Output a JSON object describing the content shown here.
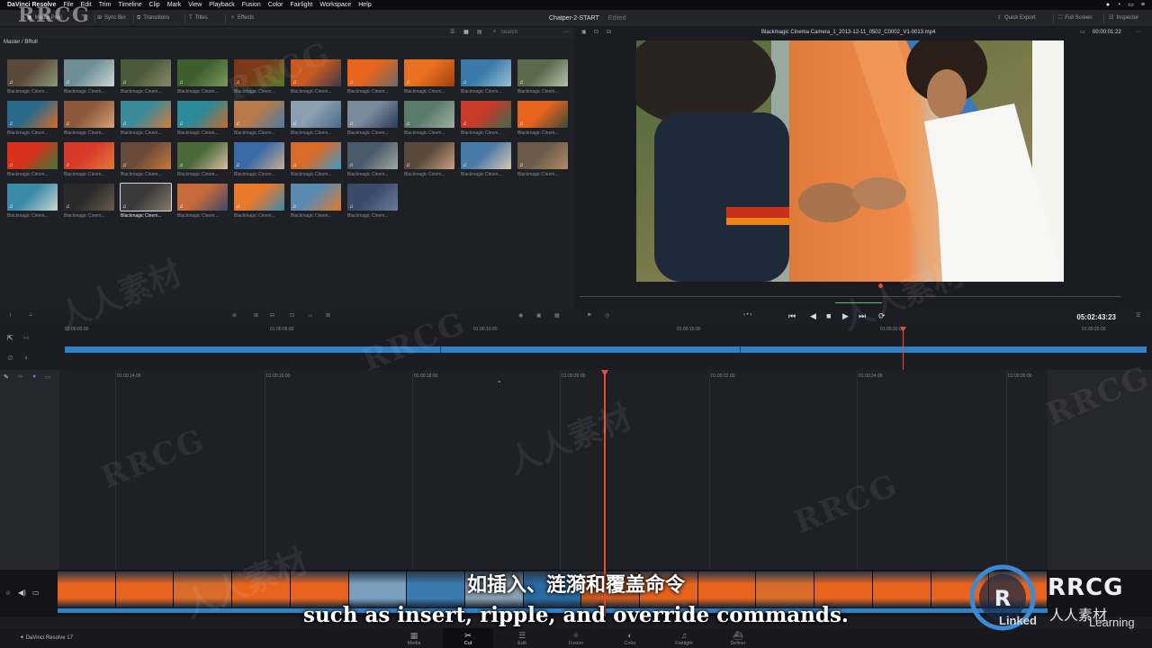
{
  "menubar": {
    "app_name": "DaVinci Resolve",
    "items": [
      "File",
      "Edit",
      "Trim",
      "Timeline",
      "Clip",
      "Mark",
      "View",
      "Playback",
      "Fusion",
      "Color",
      "Fairlight",
      "Workspace",
      "Help"
    ]
  },
  "toolbar": {
    "media_pool": "Media Pool",
    "sync_bin": "Sync Bin",
    "transitions": "Transitions",
    "titles": "Titles",
    "effects": "Effects",
    "project_title": "Chatper-2-START",
    "project_status": "Edited",
    "quick_export": "Quick Export",
    "full_screen": "Full Screen",
    "inspector": "Inspector"
  },
  "media_pool": {
    "search_placeholder": "Search",
    "bin_path": "Master / BRoll",
    "clips": [
      {
        "label": "Blackmagic Cinem...",
        "c1": "#5a4a3a",
        "c2": "#8a9a7a"
      },
      {
        "label": "Blackmagic Cinem...",
        "c1": "#6e8f95",
        "c2": "#cdd8d5"
      },
      {
        "label": "Blackmagic Cinem...",
        "c1": "#4a5a3a",
        "c2": "#8a8a6a"
      },
      {
        "label": "Blackmagic Cinem...",
        "c1": "#3e5e2e",
        "c2": "#7a9a5a"
      },
      {
        "label": "Blackmagic Cinem...",
        "c1": "#7a3a1a",
        "c2": "#5a7a2a"
      },
      {
        "label": "Blackmagic Cinem...",
        "c1": "#c85a20",
        "c2": "#3a3a4a"
      },
      {
        "label": "Blackmagic Cinem...",
        "c1": "#e8641c",
        "c2": "#6a6a6a"
      },
      {
        "label": "Blackmagic Cinem...",
        "c1": "#e8701e",
        "c2": "#a04010"
      },
      {
        "label": "Blackmagic Cinem...",
        "c1": "#3a7aa8",
        "c2": "#9ac0d8"
      },
      {
        "label": "Blackmagic Cinem...",
        "c1": "#5a6a4a",
        "c2": "#b8c0b0"
      },
      {
        "label": "Blackmagic Cinem...",
        "c1": "#2a6a8a",
        "c2": "#d86a2a"
      },
      {
        "label": "Blackmagic Cinem...",
        "c1": "#8a5a3a",
        "c2": "#d8a078"
      },
      {
        "label": "Blackmagic Cinem...",
        "c1": "#3a8a9a",
        "c2": "#d87a3a"
      },
      {
        "label": "Blackmagic Cinem...",
        "c1": "#2a8a9a",
        "c2": "#c86a2a"
      },
      {
        "label": "Blackmagic Cinem...",
        "c1": "#b87a4a",
        "c2": "#4a7aa8"
      },
      {
        "label": "Blackmagic Cinem...",
        "c1": "#8aa0b0",
        "c2": "#4a6a8a"
      },
      {
        "label": "Blackmagic Cinem...",
        "c1": "#7a8a9a",
        "c2": "#2a3a5a"
      },
      {
        "label": "Blackmagic Cinem...",
        "c1": "#5a7a6a",
        "c2": "#a0b0a0"
      },
      {
        "label": "Blackmagic Cinem...",
        "c1": "#c83a2a",
        "c2": "#3a6a4a"
      },
      {
        "label": "Blackmagic Cinem...",
        "c1": "#e8641c",
        "c2": "#3a4a3a"
      },
      {
        "label": "Blackmagic Cinem...",
        "c1": "#d8301a",
        "c2": "#3a7a3a"
      },
      {
        "label": "Blackmagic Cinem...",
        "c1": "#d83a2a",
        "c2": "#e07a3a"
      },
      {
        "label": "Blackmagic Cinem...",
        "c1": "#6a4a3a",
        "c2": "#c87a3a"
      },
      {
        "label": "Blackmagic Cinem...",
        "c1": "#4a6a3a",
        "c2": "#d8c0a0"
      },
      {
        "label": "Blackmagic Cinem...",
        "c1": "#3a6aa8",
        "c2": "#c8b090"
      },
      {
        "label": "Blackmagic Cinem...",
        "c1": "#d86a2a",
        "c2": "#3a9ac8"
      },
      {
        "label": "Blackmagic Cinem...",
        "c1": "#4a5a6a",
        "c2": "#a0a8a0"
      },
      {
        "label": "Blackmagic Cinem...",
        "c1": "#5a4a3a",
        "c2": "#c8a080"
      },
      {
        "label": "Blackmagic Cinem...",
        "c1": "#4a7aa8",
        "c2": "#d8c8b0"
      },
      {
        "label": "Blackmagic Cinem...",
        "c1": "#6a5a4a",
        "c2": "#b08a6a"
      },
      {
        "label": "Blackmagic Cinem...",
        "c1": "#3a8aa8",
        "c2": "#c8d8d0"
      },
      {
        "label": "Blackmagic Cinem...",
        "c1": "#2a2a2a",
        "c2": "#6a5a4a"
      },
      {
        "label": "Blackmagic Cinem...",
        "c1": "#3a3a3a",
        "c2": "#8a7a6a"
      },
      {
        "label": "Blackmagic Cinem...",
        "c1": "#c86a3a",
        "c2": "#3a4a6a"
      },
      {
        "label": "Blackmagic Cinem...",
        "c1": "#e8782a",
        "c2": "#3a8ab0"
      },
      {
        "label": "Blackmagic Cinem...",
        "c1": "#5a8ab0",
        "c2": "#e07a2a"
      },
      {
        "label": "Blackmagic Cinem...",
        "c1": "#3a4a6a",
        "c2": "#6a7a9a"
      }
    ],
    "selected_index": 32
  },
  "viewer": {
    "clip_name": "Blackmagic Cinema Camera_1_2013-12-11_0502_C0002_V1-0013.mp4",
    "timecode": "00:00:01:22"
  },
  "transport": {
    "timecode": "05:02:43:23"
  },
  "upper_timeline": {
    "ruler": [
      "01:00:00:00",
      "01:00:05:00",
      "01:00:10:00",
      "01:00:15:00",
      "01:00:20:00",
      "01:00:25:00"
    ]
  },
  "lower_timeline": {
    "ruler": [
      "01:00:14:00",
      "01:00:16:00",
      "01:00:18:00",
      "01:00:20:00",
      "01:00:22:00",
      "01:00:24:00",
      "01:00:26:00"
    ]
  },
  "clip_strip": {
    "colors": [
      "#e8641c",
      "#e8641c",
      "#d86a2a",
      "#e8641c",
      "#e8641c",
      "#7aa0c0",
      "#3a7ab0",
      "#8aa0b0",
      "#2a6aa0",
      "#c85a20",
      "#e8641c",
      "#e8641c",
      "#d86a2a",
      "#e8641c",
      "#e8641c",
      "#e8641c",
      "#e8641c"
    ]
  },
  "pages": [
    "Media",
    "Cut",
    "Edit",
    "Fusion",
    "Color",
    "Fairlight",
    "Deliver"
  ],
  "active_page": "Cut",
  "footer_app": "DaVinci Resolve 17",
  "subtitle": {
    "cn": "如插入、涟漪和覆盖命令",
    "en": "such as insert, ripple, and override commands."
  },
  "watermark": {
    "logo_text": "RRCG",
    "logo_sub": "人人素材",
    "linked_text": "Linked",
    "learning_text": "Learning"
  }
}
